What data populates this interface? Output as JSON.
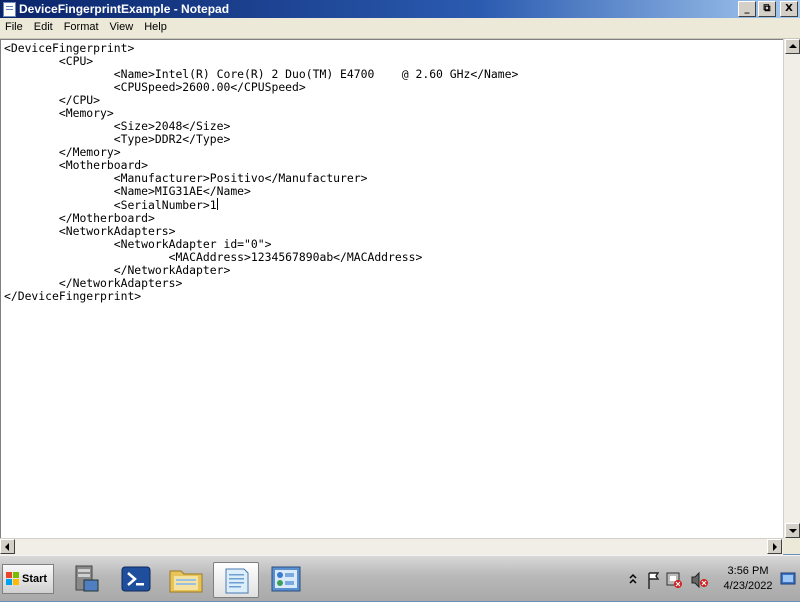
{
  "window": {
    "title": "DeviceFingerprintExample - Notepad"
  },
  "window_controls": {
    "minimize": "_",
    "maximize": "⧉",
    "close": "X"
  },
  "menu": {
    "file": "File",
    "edit": "Edit",
    "format": "Format",
    "view": "View",
    "help": "Help"
  },
  "document": {
    "lines": [
      "<DeviceFingerprint>",
      "\t<CPU>",
      "\t\t<Name>Intel(R) Core(R) 2 Duo(TM) E4700    @ 2.60 GHz</Name>",
      "\t\t<CPUSpeed>2600.00</CPUSpeed>",
      "\t</CPU>",
      "\t<Memory>",
      "\t\t<Size>2048</Size>",
      "\t\t<Type>DDR2</Type>",
      "\t</Memory>",
      "\t<Motherboard>",
      "\t\t<Manufacturer>Positivo</Manufacturer>",
      "\t\t<Name>MIG31AE</Name>",
      "\t\t<SerialNumber>1",
      "\t</Motherboard>",
      "\t<NetworkAdapters>",
      "\t\t<NetworkAdapter id=\"0\">",
      "\t\t\t<MACAddress>1234567890ab</MACAddress>",
      "\t\t</NetworkAdapter>",
      "\t</NetworkAdapters>",
      "</DeviceFingerprint>"
    ]
  },
  "taskbar": {
    "start_label": "Start",
    "apps": [
      {
        "icon": "server-manager-icon"
      },
      {
        "icon": "powershell-icon"
      },
      {
        "icon": "folder-icon"
      },
      {
        "icon": "notepad-icon",
        "active": true
      },
      {
        "icon": "control-panel-icon"
      }
    ],
    "clock_time": "3:56 PM",
    "clock_date": "4/23/2022"
  }
}
